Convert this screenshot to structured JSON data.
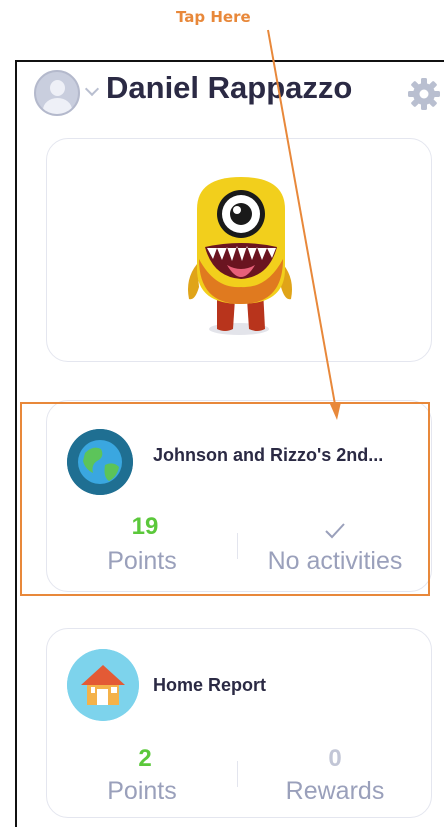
{
  "annotation": {
    "label": "Tap Here",
    "color": "#e8883a"
  },
  "header": {
    "user_name": "Daniel Rappazzo",
    "avatar_icon": "user-avatar-icon",
    "settings_icon": "gear-icon"
  },
  "cards": {
    "class": {
      "title": "Johnson and Rizzo's 2nd...",
      "points_value": "19",
      "points_label": "Points",
      "activity_label": "No activities",
      "points_color": "#5bc83b"
    },
    "home": {
      "title": "Home Report",
      "points_value": "2",
      "points_label": "Points",
      "rewards_value": "0",
      "rewards_label": "Rewards"
    }
  },
  "colors": {
    "text_dark": "#2b2a44",
    "text_muted": "#9aa0bb",
    "accent_green": "#5bc83b",
    "annotation_orange": "#e8883a"
  }
}
